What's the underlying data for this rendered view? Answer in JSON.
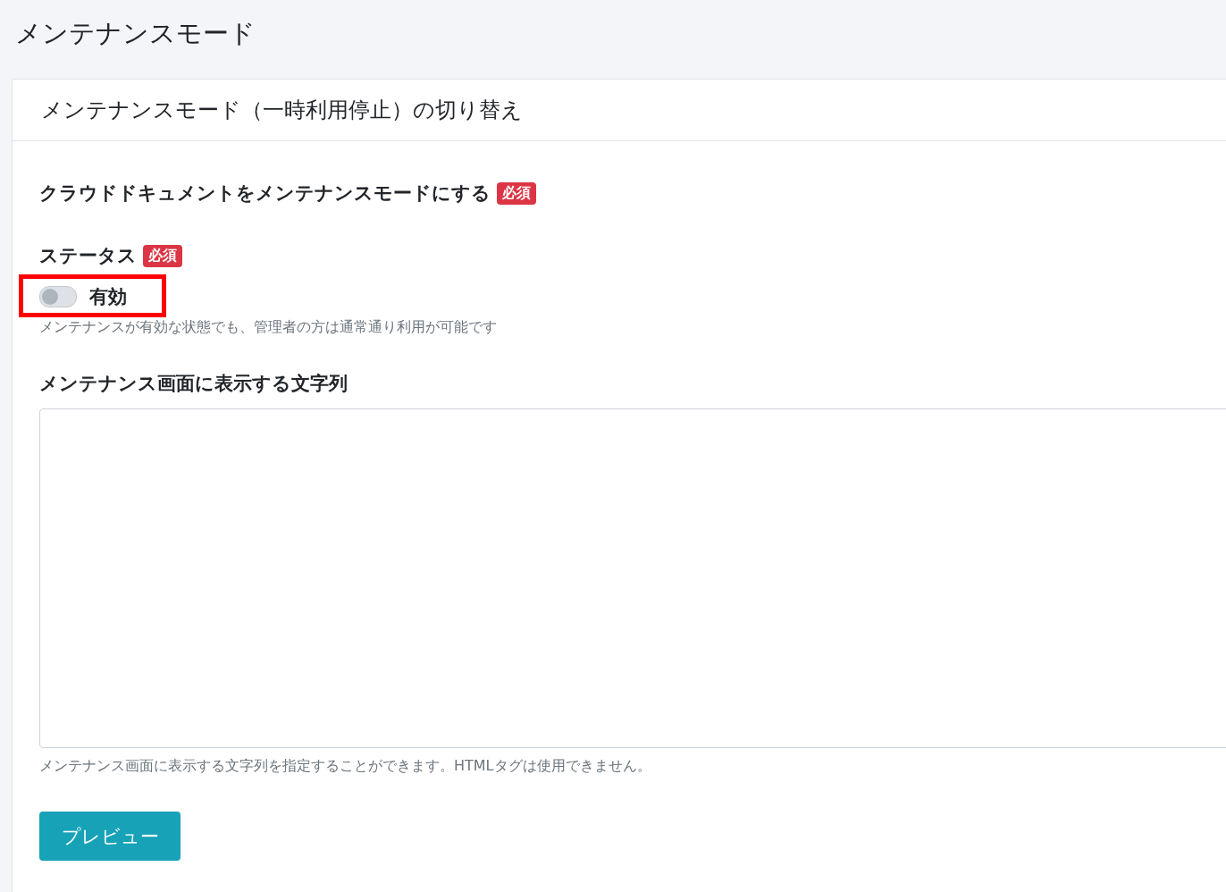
{
  "page": {
    "title": "メンテナンスモード"
  },
  "card": {
    "title": "メンテナンスモード（一時利用停止）の切り替え",
    "section_title": "クラウドドキュメントをメンテナンスモードにする",
    "section_required": "必須",
    "status": {
      "label": "ステータス",
      "required": "必須",
      "toggle_label": "有効",
      "checked": false,
      "highlighted": true,
      "help": "メンテナンスが有効な状態でも、管理者の方は通常通り利用が可能です"
    },
    "message": {
      "label": "メンテナンス画面に表示する文字列",
      "help": "メンテナンス画面に表示する文字列を指定することができます。HTMLタグは使用できません。"
    },
    "preview_button": "プレビュー"
  }
}
